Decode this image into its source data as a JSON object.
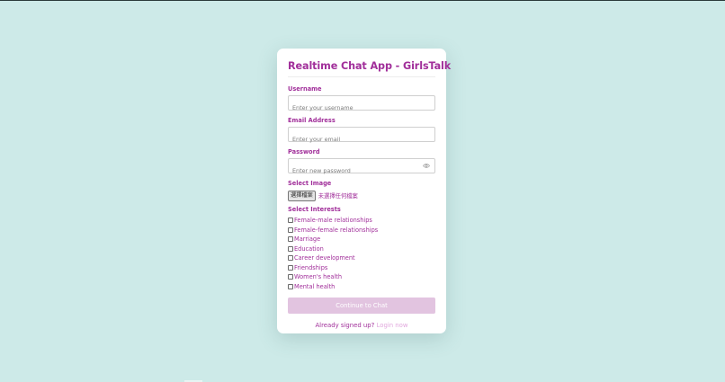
{
  "page": {
    "background_color": "#cdeae8",
    "accent_color": "#a12f9a"
  },
  "form": {
    "title": "Realtime Chat App - GirlsTalk",
    "username": {
      "label": "Username",
      "placeholder": "Enter your username",
      "value": ""
    },
    "email": {
      "label": "Email Address",
      "placeholder": "Enter your email",
      "value": ""
    },
    "password": {
      "label": "Password",
      "placeholder": "Enter new password",
      "value": "",
      "toggle_icon": "eye-icon"
    },
    "image": {
      "label": "Select Image",
      "button_label": "選擇檔案",
      "status_text": "未選擇任何檔案"
    },
    "interests": {
      "label": "Select Interests",
      "items": [
        {
          "label": "Female-male relationships",
          "checked": false
        },
        {
          "label": "Female-female relationships",
          "checked": false
        },
        {
          "label": "Marriage",
          "checked": false
        },
        {
          "label": "Education",
          "checked": false
        },
        {
          "label": "Career development",
          "checked": false
        },
        {
          "label": "Friendships",
          "checked": false
        },
        {
          "label": "Women's health",
          "checked": false
        },
        {
          "label": "Mental health",
          "checked": false
        }
      ]
    },
    "submit_label": "Continue to Chat",
    "footer": {
      "text": "Already signed up?",
      "link_label": "Login now"
    }
  }
}
